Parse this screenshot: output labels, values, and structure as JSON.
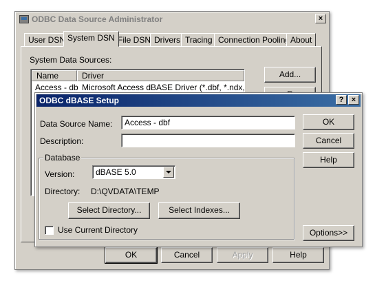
{
  "admin": {
    "title": "ODBC Data Source Administrator",
    "close_glyph": "×",
    "tabs": [
      "User DSN",
      "System DSN",
      "File DSN",
      "Drivers",
      "Tracing",
      "Connection Pooling",
      "About"
    ],
    "section_label": "System Data Sources:",
    "columns": [
      "Name",
      "Driver"
    ],
    "rows": [
      {
        "name": "Access - dbf",
        "driver": "Microsoft Access dBASE Driver (*.dbf, *.ndx, *.mdx)"
      }
    ],
    "add_label": "Add...",
    "remove_label": "R",
    "footer": {
      "ok": "OK",
      "cancel": "Cancel",
      "apply": "Apply",
      "help": "Help"
    }
  },
  "setup": {
    "title": "ODBC dBASE Setup",
    "help_glyph": "?",
    "close_glyph": "×",
    "dsn_label": "Data Source Name:",
    "dsn_value": "Access - dbf",
    "desc_label": "Description:",
    "desc_value": "",
    "database_group": "Database",
    "version_label": "Version:",
    "version_value": "dBASE 5.0",
    "directory_label": "Directory:",
    "directory_value": "D:\\QVDATA\\TEMP",
    "select_directory": "Select Directory...",
    "select_indexes": "Select Indexes...",
    "use_current_directory": "Use Current Directory",
    "use_current_checked": false,
    "ok": "OK",
    "cancel": "Cancel",
    "help": "Help",
    "options": "Options>>"
  },
  "icons": [
    "odbc-admin-icon",
    "close-icon",
    "help-icon",
    "chevron-down-icon"
  ]
}
